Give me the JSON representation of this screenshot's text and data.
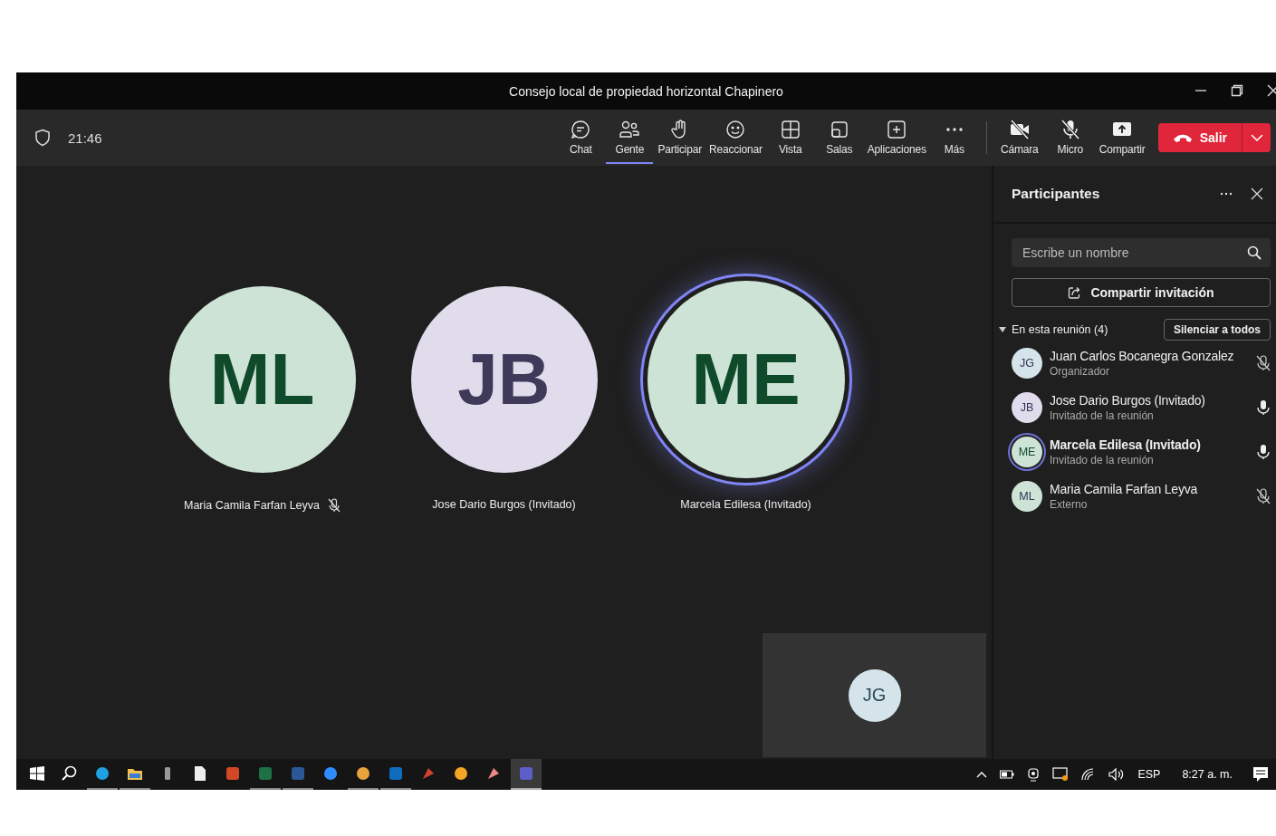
{
  "window": {
    "title": "Consejo local de propiedad horizontal Chapinero"
  },
  "meeting": {
    "duration": "21:46"
  },
  "toolbar": {
    "items": [
      {
        "kind": "chat",
        "label": "Chat",
        "selected": false
      },
      {
        "kind": "people",
        "label": "Gente",
        "selected": true
      },
      {
        "kind": "hand",
        "label": "Participar",
        "selected": false
      },
      {
        "kind": "react",
        "label": "Reaccionar",
        "selected": false
      },
      {
        "kind": "view",
        "label": "Vista",
        "selected": false
      },
      {
        "kind": "rooms",
        "label": "Salas",
        "selected": false
      },
      {
        "kind": "apps",
        "label": "Aplicaciones",
        "selected": false
      },
      {
        "kind": "more",
        "label": "Más",
        "selected": false
      }
    ],
    "devices": [
      {
        "kind": "camera",
        "label": "Cámara",
        "on": false
      },
      {
        "kind": "mic",
        "label": "Micro",
        "on": false
      },
      {
        "kind": "share",
        "label": "Compartir",
        "on": true
      }
    ],
    "leave_button": "Salir"
  },
  "stage": {
    "tiles": [
      {
        "initials": "ML",
        "name": "Maria Camila Farfan Leyva",
        "muted": true,
        "speaking": false,
        "color": "#cde3d6"
      },
      {
        "initials": "JB",
        "name": "Jose Dario Burgos (Invitado)",
        "muted": false,
        "speaking": false,
        "color": "#e0dcec"
      },
      {
        "initials": "ME",
        "name": "Marcela Edilesa (Invitado)",
        "muted": false,
        "speaking": true,
        "color": "#cde3d6"
      }
    ],
    "self_view": {
      "initials": "JG"
    }
  },
  "panel": {
    "title": "Participantes",
    "search": {
      "placeholder": "Escribe un nombre"
    },
    "invite_button": "Compartir invitación",
    "section": {
      "label": "En esta reunión (4)",
      "expanded": true,
      "mute_all_button": "Silenciar a todos",
      "participants": [
        {
          "initials": "JG",
          "name": "Juan Carlos Bocanegra Gonzalez",
          "role": "Organizador",
          "muted": true,
          "speaking": false,
          "color": "#d5e3ea"
        },
        {
          "initials": "JB",
          "name": "Jose Dario Burgos (Invitado)",
          "role": "Invitado de la reunión",
          "muted": false,
          "speaking": false,
          "color": "#e0dcec"
        },
        {
          "initials": "ME",
          "name": "Marcela Edilesa (Invitado)",
          "role": "Invitado de la reunión",
          "muted": false,
          "speaking": true,
          "color": "#cde3d6"
        },
        {
          "initials": "ML",
          "name": "Maria Camila Farfan Leyva",
          "role": "Externo",
          "muted": true,
          "speaking": false,
          "color": "#cde3d6"
        }
      ]
    }
  },
  "taskbar": {
    "apps": [
      {
        "running": false,
        "selected": false
      },
      {
        "running": false,
        "selected": false
      },
      {
        "running": true,
        "selected": false
      },
      {
        "running": true,
        "selected": false
      },
      {
        "running": false,
        "selected": false
      },
      {
        "running": false,
        "selected": false
      },
      {
        "running": false,
        "selected": false
      },
      {
        "running": true,
        "selected": false
      },
      {
        "running": true,
        "selected": false
      },
      {
        "running": false,
        "selected": false
      },
      {
        "running": true,
        "selected": false
      },
      {
        "running": true,
        "selected": false
      },
      {
        "running": false,
        "selected": false
      },
      {
        "running": false,
        "selected": false
      },
      {
        "running": false,
        "selected": false
      },
      {
        "running": true,
        "selected": true
      }
    ],
    "language": "ESP",
    "time": "8:27 a. m."
  }
}
